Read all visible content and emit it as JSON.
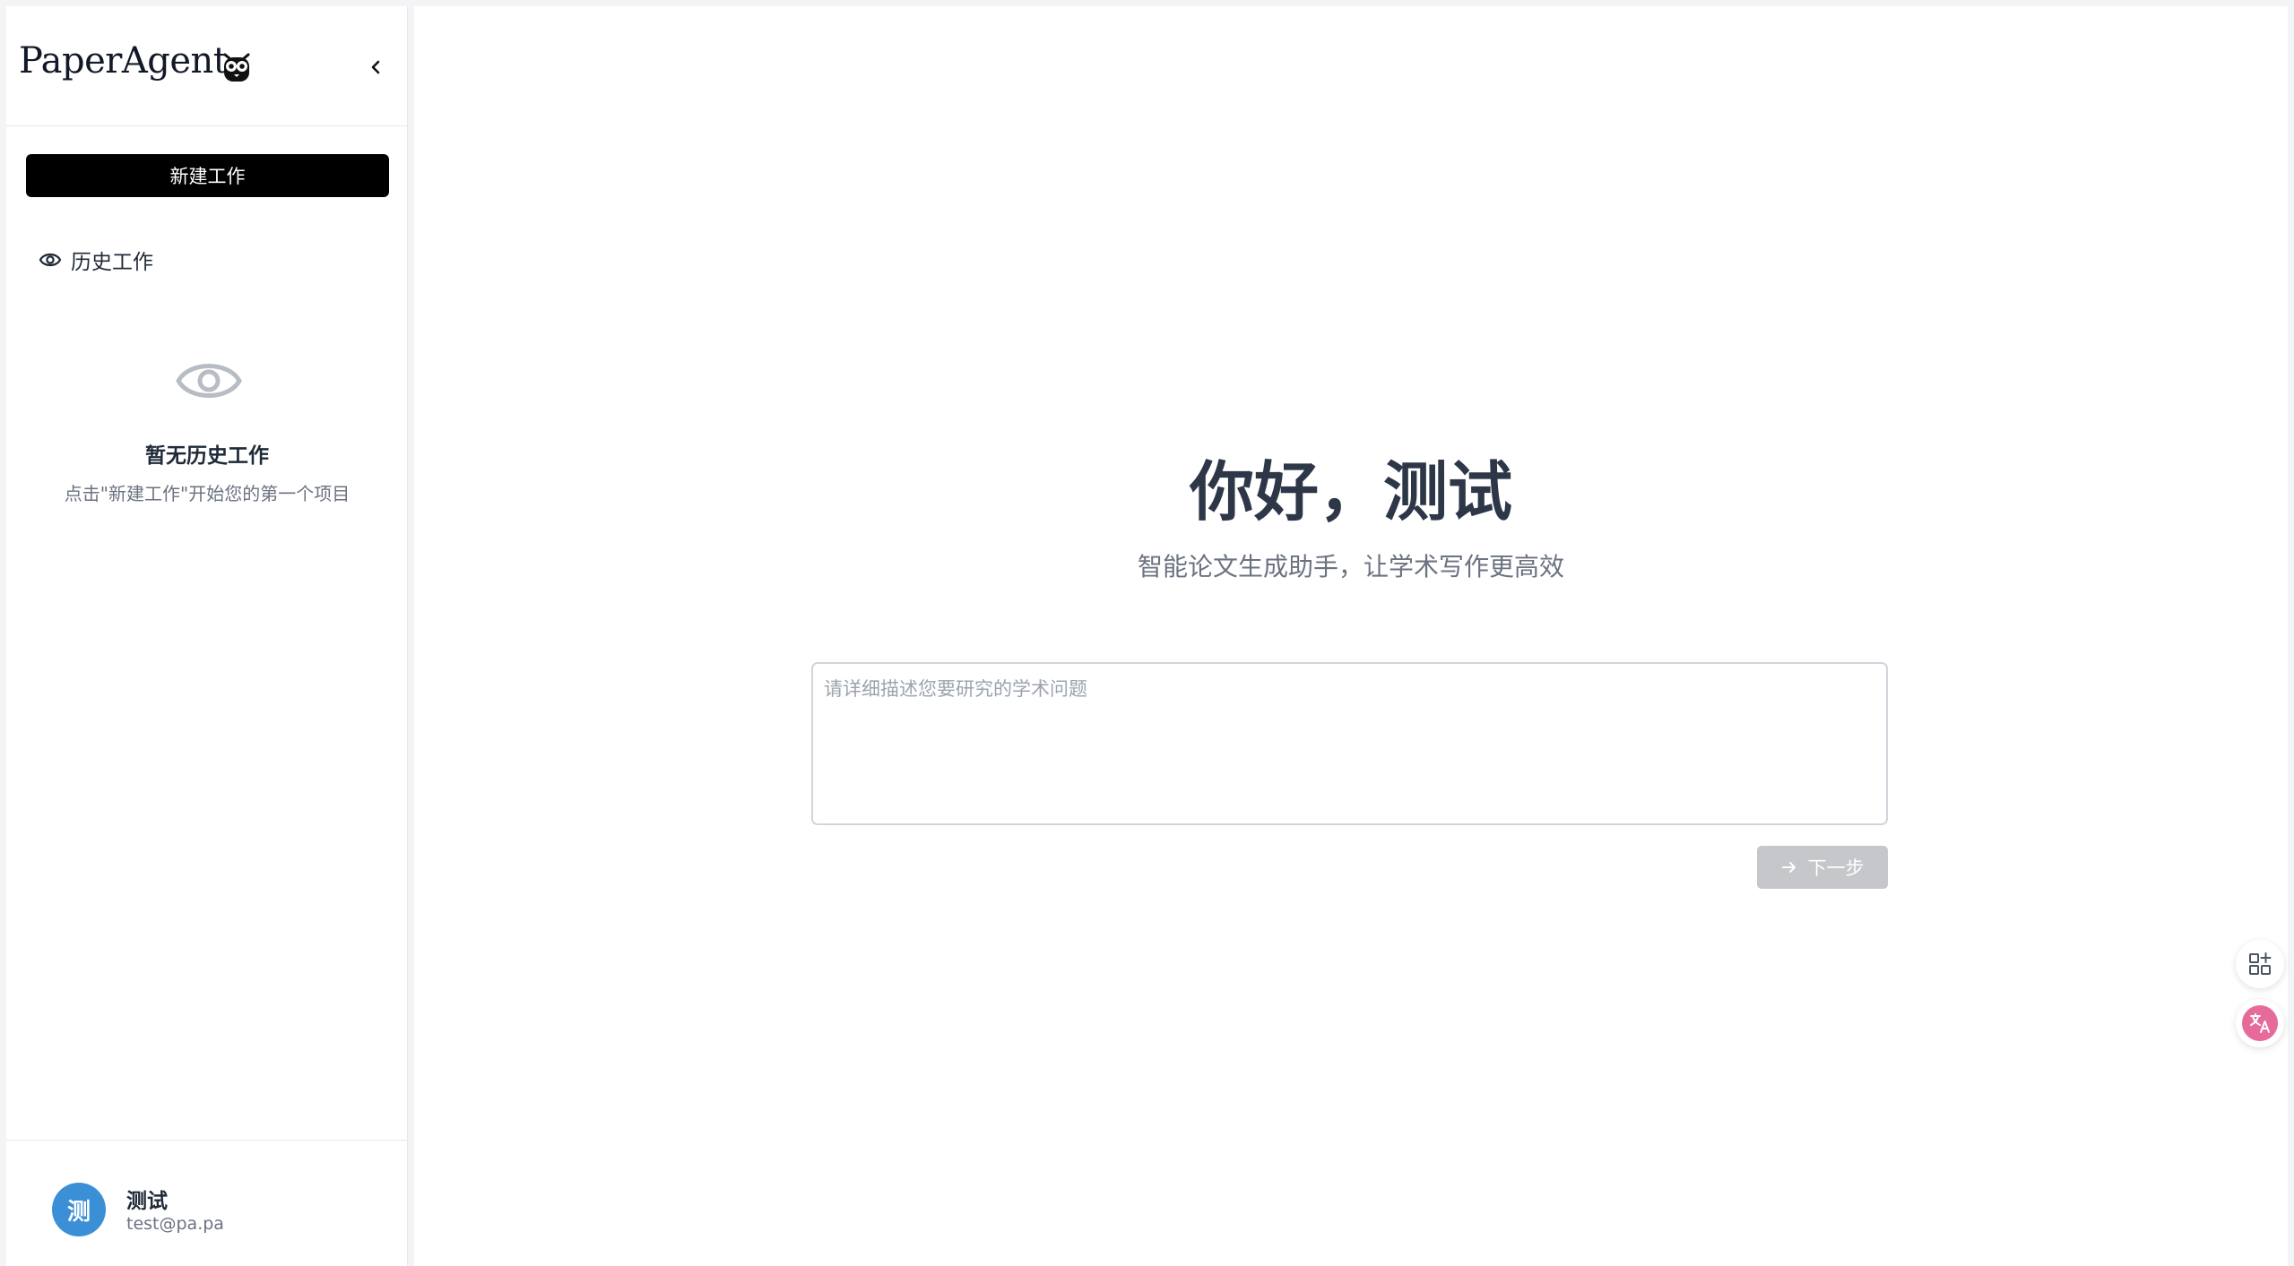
{
  "sidebar": {
    "logo_text": "PaperAgent",
    "new_work_label": "新建工作",
    "history_label": "历史工作",
    "empty_title": "暂无历史工作",
    "empty_subtitle": "点击\"新建工作\"开始您的第一个项目"
  },
  "user": {
    "avatar_initial": "测",
    "name": "测试",
    "email": "test@pa.pa"
  },
  "main": {
    "greeting": "你好，测试",
    "subtitle": "智能论文生成助手，让学术写作更高效",
    "input_placeholder": "请详细描述您要研究的学术问题",
    "next_label": "下一步"
  },
  "colors": {
    "primary_button": "#000000",
    "avatar": "#3b8fd6",
    "disabled_button": "#c5c7cb",
    "translate_accent": "#e66a9a"
  },
  "icons": [
    "owl-icon",
    "chevron-left-icon",
    "eye-icon",
    "arrow-right-icon",
    "apps-icon",
    "translate-icon"
  ]
}
